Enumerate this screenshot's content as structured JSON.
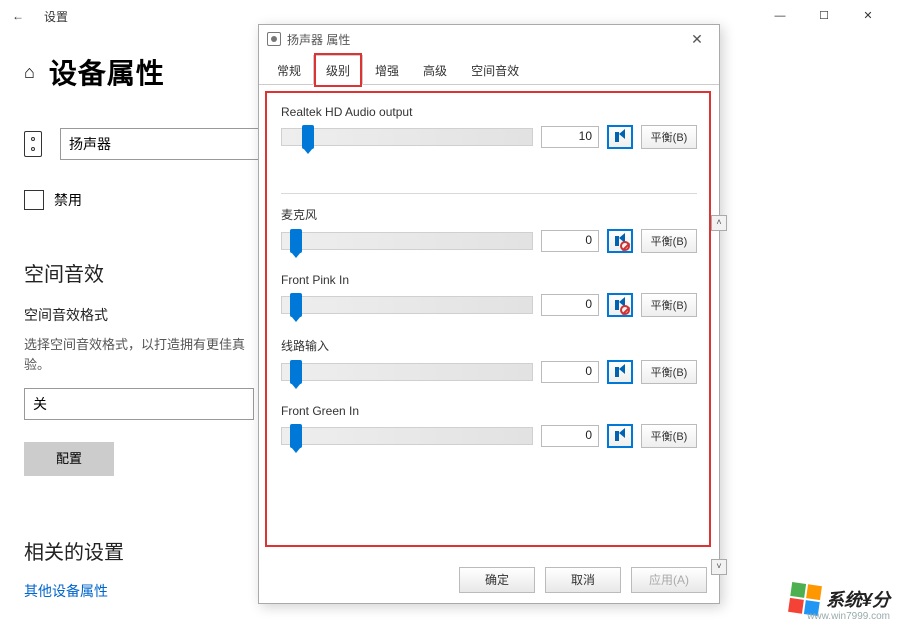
{
  "settings": {
    "back_icon": "←",
    "window_title": "设置",
    "min_glyph": "—",
    "max_glyph": "☐",
    "close_glyph": "✕",
    "page_title": "设备属性",
    "device_name": "扬声器",
    "disable_label": "禁用",
    "spatial_heading": "空间音效",
    "spatial_sub": "空间音效格式",
    "spatial_desc": "选择空间音效格式，以打造拥有更佳真验。",
    "spatial_selected": "关",
    "configure_label": "配置",
    "related_heading": "相关的设置",
    "related_link": "其他设备属性"
  },
  "dialog": {
    "title": "扬声器 属性",
    "close_glyph": "✕",
    "tabs": [
      "常规",
      "级别",
      "增强",
      "高级",
      "空间音效"
    ],
    "active_tab_index": 1,
    "groups": [
      {
        "label": "Realtek HD Audio output",
        "value": "10",
        "thumb_pct": 8,
        "muted": false
      },
      {
        "label": "麦克风",
        "value": "0",
        "thumb_pct": 3,
        "muted": true
      },
      {
        "label": "Front Pink In",
        "value": "0",
        "thumb_pct": 3,
        "muted": true
      },
      {
        "label": "线路输入",
        "value": "0",
        "thumb_pct": 3,
        "muted": false
      },
      {
        "label": "Front Green In",
        "value": "0",
        "thumb_pct": 3,
        "muted": false
      }
    ],
    "balance_label": "平衡(B)",
    "buttons": {
      "ok": "确定",
      "cancel": "取消",
      "apply": "应用(A)"
    },
    "scroll_up": "˄",
    "scroll_down": "˅"
  },
  "watermark": {
    "text": "系统¥分",
    "url": "www.win7999.com"
  }
}
